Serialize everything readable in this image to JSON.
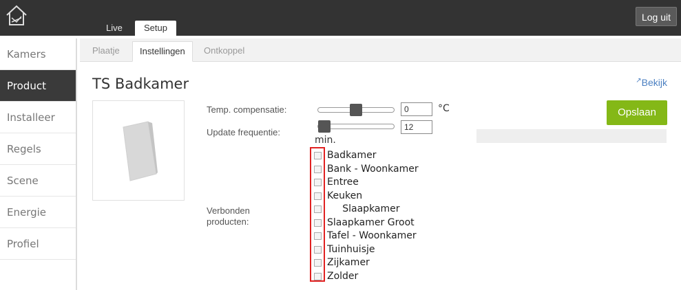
{
  "header": {
    "tabs": [
      {
        "label": "Live"
      },
      {
        "label": "Setup"
      }
    ],
    "logout_label": "Log uit",
    "logo_icon": "home-icon"
  },
  "sidebar": {
    "items": [
      {
        "label": "Kamers"
      },
      {
        "label": "Product"
      },
      {
        "label": "Installeer"
      },
      {
        "label": "Regels"
      },
      {
        "label": "Scene"
      },
      {
        "label": "Energie"
      },
      {
        "label": "Profiel"
      }
    ],
    "active_index": 1
  },
  "subtabs": [
    {
      "label": "Plaatje"
    },
    {
      "label": "Instellingen"
    },
    {
      "label": "Ontkoppel"
    }
  ],
  "product": {
    "title": "TS Badkamer",
    "view_link": "Bekijk",
    "save_label": "Opslaan"
  },
  "settings": {
    "temp_label": "Temp. compensatie:",
    "temp_value": "0",
    "temp_unit": "°C",
    "temp_slider_fraction": 0.5,
    "update_label": "Update frequentie:",
    "update_value": "12",
    "update_unit": "min.",
    "update_slider_fraction": 0.0,
    "connected_label": "Verbonden producten:"
  },
  "connected_products": [
    {
      "label": "Badkamer",
      "checked": false
    },
    {
      "label": "Bank - Woonkamer",
      "checked": false
    },
    {
      "label": "Entree",
      "checked": false
    },
    {
      "label": "Keuken",
      "checked": false
    },
    {
      "label": "     Slaapkamer",
      "checked": false
    },
    {
      "label": "Slaapkamer Groot",
      "checked": false
    },
    {
      "label": "Tafel - Woonkamer",
      "checked": false
    },
    {
      "label": "Tuinhuisje",
      "checked": false
    },
    {
      "label": "Zijkamer",
      "checked": false
    },
    {
      "label": "Zolder",
      "checked": false
    }
  ],
  "colors": {
    "accent_green": "#84b817",
    "highlight_red": "#e02020",
    "link_blue": "#4a7fc1"
  }
}
